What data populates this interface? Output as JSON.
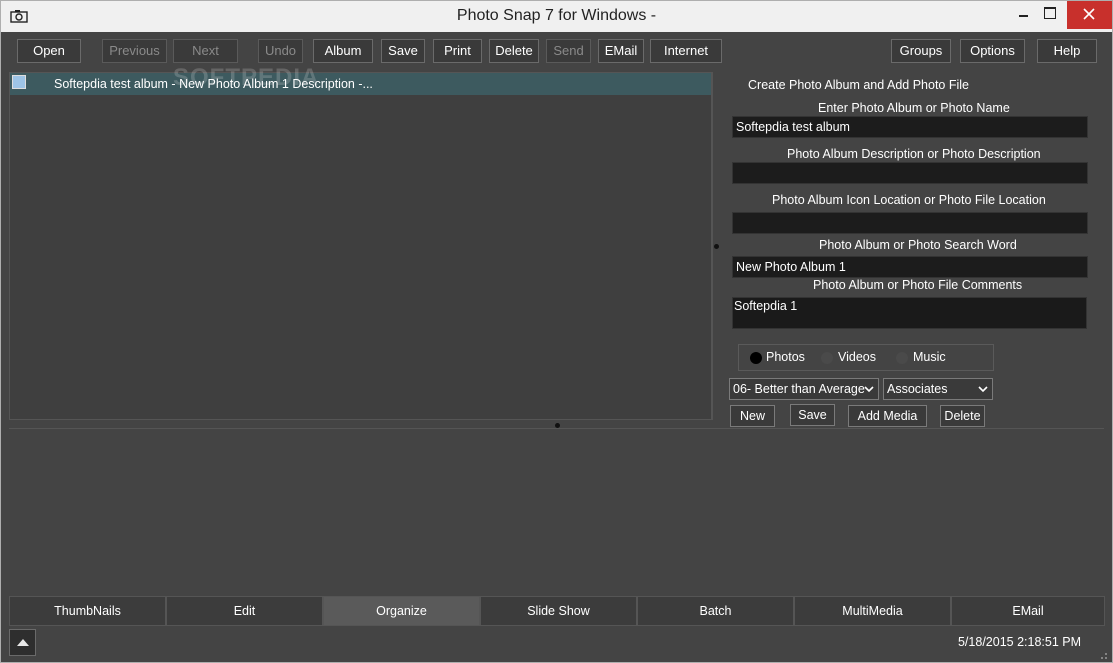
{
  "window": {
    "title": "Photo Snap 7 for Windows -"
  },
  "toolbar": {
    "open": "Open",
    "previous": "Previous",
    "next": "Next",
    "undo": "Undo",
    "album": "Album",
    "save": "Save",
    "print": "Print",
    "delete": "Delete",
    "send": "Send",
    "email": "EMail",
    "internet": "Internet",
    "groups": "Groups",
    "options": "Options",
    "help": "Help"
  },
  "list": {
    "watermark": "SOFTPEDIA",
    "items": [
      {
        "text": "Softepdia test album - New Photo Album 1 Description -..."
      }
    ]
  },
  "form": {
    "heading": "Create Photo Album and Add Photo File",
    "name_label": "Enter Photo Album or Photo Name",
    "name_value": "Softepdia test album",
    "desc_label": "Photo Album Description or Photo Description",
    "desc_value": "",
    "icon_label": "Photo Album Icon Location or Photo File Location",
    "icon_value": "",
    "search_label": "Photo Album or Photo Search Word",
    "search_value": "New Photo Album 1",
    "comments_label": "Photo Album or Photo File Comments",
    "comments_value": "Softepdia 1",
    "media_types": [
      {
        "label": "Photos",
        "selected": true
      },
      {
        "label": "Videos",
        "selected": false
      },
      {
        "label": "Music",
        "selected": false
      }
    ],
    "rating": "06-  Better than Average",
    "group": "Associates",
    "buttons": {
      "new": "New",
      "save": "Save",
      "add_media": "Add Media",
      "delete": "Delete"
    }
  },
  "tabs": [
    {
      "label": "ThumbNails",
      "active": false
    },
    {
      "label": "Edit",
      "active": false
    },
    {
      "label": "Organize",
      "active": true
    },
    {
      "label": "Slide Show",
      "active": false
    },
    {
      "label": "Batch",
      "active": false
    },
    {
      "label": "MultiMedia",
      "active": false
    },
    {
      "label": "EMail",
      "active": false
    }
  ],
  "status": {
    "datetime": "5/18/2015 2:18:51 PM"
  },
  "colors": {
    "background": "#444444",
    "selected_row": "#3d5a5f",
    "close_button": "#c8302c",
    "input_bg": "#1c1c1c"
  }
}
